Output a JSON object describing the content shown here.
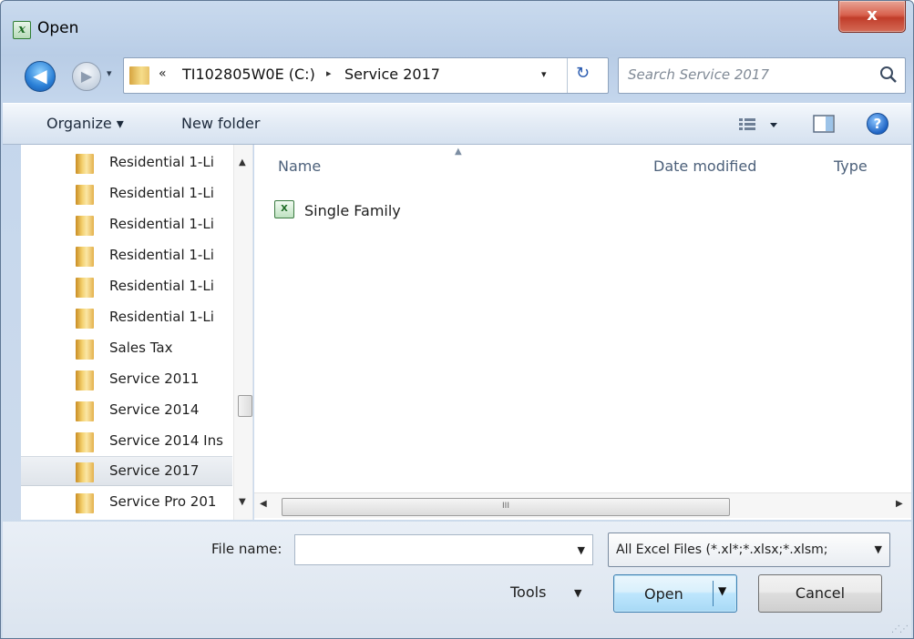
{
  "window": {
    "title": "Open",
    "app_icon": "excel-icon",
    "close_symbol": "x"
  },
  "navigation": {
    "back_symbol": "◀",
    "forward_symbol": "▶",
    "history_symbol": "▾",
    "breadcrumb_overflow": "«",
    "segments": [
      "TI102805W0E (C:)",
      "Service 2017"
    ],
    "separator": "▸",
    "dropdown_symbol": "▾",
    "refresh_symbol": "↻"
  },
  "search": {
    "placeholder": "Search Service 2017"
  },
  "toolbar": {
    "organize_label": "Organize ▾",
    "new_folder_label": "New folder",
    "help_symbol": "?"
  },
  "nav_pane": {
    "items": [
      {
        "label": "Residential 1-Li"
      },
      {
        "label": "Residential 1-Li"
      },
      {
        "label": "Residential 1-Li"
      },
      {
        "label": "Residential 1-Li"
      },
      {
        "label": "Residential 1-Li"
      },
      {
        "label": "Residential 1-Li"
      },
      {
        "label": "Sales Tax"
      },
      {
        "label": "Service 2011"
      },
      {
        "label": "Service 2014"
      },
      {
        "label": "Service 2014 Ins"
      },
      {
        "label": "Service 2017",
        "selected": true
      },
      {
        "label": "Service Pro 201"
      }
    ]
  },
  "file_list": {
    "columns": [
      "Name",
      "Date modified",
      "Type"
    ],
    "files": [
      {
        "name": "Single Family",
        "icon": "excel-file-icon"
      }
    ],
    "scroll_grip": "III"
  },
  "footer": {
    "file_name_label": "File name:",
    "file_name_value": "",
    "file_type_filter": "All Excel Files (*.xl*;*.xlsx;*.xlsm;",
    "tools_label": "Tools",
    "open_label": "Open",
    "cancel_label": "Cancel"
  },
  "colors": {
    "chrome": "#c4d6ec",
    "selection": "#e3e8ee",
    "open_button_border": "#3c7fb1",
    "close_button": "#c94a36"
  }
}
